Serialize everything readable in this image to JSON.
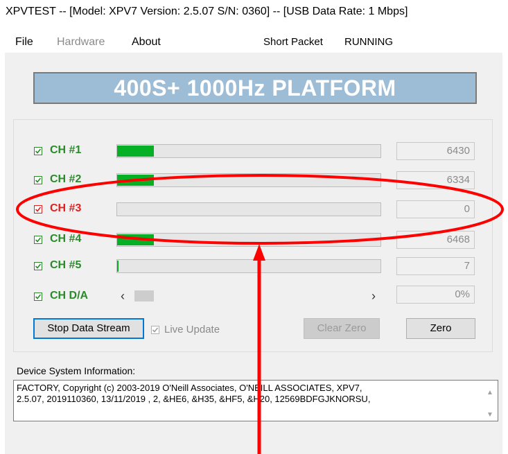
{
  "window": {
    "title": "XPVTEST -- [Model: XPV7 Version: 2.5.07 S/N: 0360] -- [USB Data Rate: 1 Mbps]"
  },
  "menu": {
    "file": "File",
    "hardware": "Hardware",
    "about": "About",
    "packet": "Short Packet",
    "status": "RUNNING"
  },
  "banner": "400S+  1000Hz PLATFORM",
  "channels": [
    {
      "label": "CH #1",
      "checked": true,
      "value": "6430",
      "level": 0.14
    },
    {
      "label": "CH #2",
      "checked": true,
      "value": "6334",
      "level": 0.14
    },
    {
      "label": "CH #3",
      "checked": true,
      "value": "0",
      "level": 0.0,
      "alert": true
    },
    {
      "label": "CH #4",
      "checked": true,
      "value": "6468",
      "level": 0.14
    },
    {
      "label": "CH #5",
      "checked": true,
      "value": "7",
      "level": 0.003
    }
  ],
  "da": {
    "label": "CH D/A",
    "value": "0%",
    "left_arrow": "‹",
    "right_arrow": "›"
  },
  "buttons": {
    "stop": "Stop Data Stream",
    "live_update": "Live Update",
    "clear_zero": "Clear Zero",
    "zero": "Zero"
  },
  "device_info": {
    "label": "Device System Information:",
    "line1": "FACTORY, Copyright (c) 2003-2019 O'Neill Associates, O'NEILL ASSOCIATES, XPV7,",
    "line2": "2.5.07, 2019110360, 13/11/2019  , 2, &HE6, &H35, &HF5, &H20, 12569BDFGJKNORSU,"
  },
  "colors": {
    "channel_ok": "#2a8a2a",
    "channel_alert": "#e02020",
    "bar_fill": "#06b025",
    "annotation": "#ff0000"
  }
}
